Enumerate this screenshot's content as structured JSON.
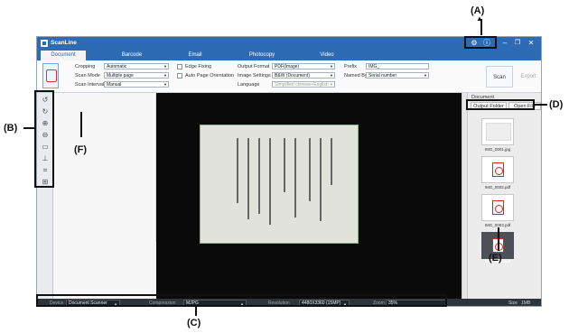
{
  "window": {
    "title": "ScanLine",
    "controls": {
      "settings_icon": "gear-icon",
      "info_icon": "info-icon"
    }
  },
  "tabs": [
    "Document",
    "Barcode",
    "Email",
    "Photocopy",
    "Video"
  ],
  "ribbon": {
    "cropping_label": "Cropping",
    "cropping_value": "Automatic",
    "scan_mode_label": "Scan Mode",
    "scan_mode_value": "Multiple page",
    "scan_interval_label": "Scan Interval",
    "scan_interval_value": "Manual",
    "edge_fixing_label": "Edge Fixing",
    "auto_orientation_label": "Auto Page Orientation",
    "output_format_label": "Output Format",
    "output_format_value": "PDF(Image)",
    "image_settings_label": "Image Settings",
    "image_settings_value": "B&W (Document)",
    "language_label": "Language",
    "language_value": "Simplified chinese+English",
    "prefix_label": "Prefix",
    "prefix_value": "IMG_",
    "named_by_label": "Named By",
    "named_by_value": "Serial number",
    "scan_button": "Scan",
    "export_button": "Export"
  },
  "left_toolbar": [
    "rotate-left-icon",
    "rotate-right-icon",
    "zoom-in-icon",
    "zoom-out-icon",
    "fit-page-icon",
    "stamp-icon",
    "crop-icon",
    "actual-size-icon"
  ],
  "right_panel": {
    "title": "Document",
    "output_folder_button": "Output Folder",
    "open_file_button": "Open File",
    "files": [
      {
        "name": "IMG_0001.jpg",
        "type": "jpg"
      },
      {
        "name": "IMG_0002.pdf",
        "type": "pdf"
      },
      {
        "name": "IMG_0003.pdf",
        "type": "pdf"
      },
      {
        "name": "IMG_0004.pdf",
        "type": "pdf"
      }
    ]
  },
  "statusbar": {
    "device_label": "Device",
    "device_value": "Document Scanner",
    "compression_label": "Compression",
    "compression_value": "MJPG",
    "resolution_label": "Resolution",
    "resolution_value": "4480X3360 (15MP)",
    "zoom_label": "Zoom",
    "zoom_value": "35%",
    "size_label": "Size",
    "size_value": "1MB"
  },
  "annotations": {
    "a": "(A)",
    "b": "(B)",
    "c": "(C)",
    "d": "(D)",
    "e": "(E)",
    "f": "(F)"
  }
}
